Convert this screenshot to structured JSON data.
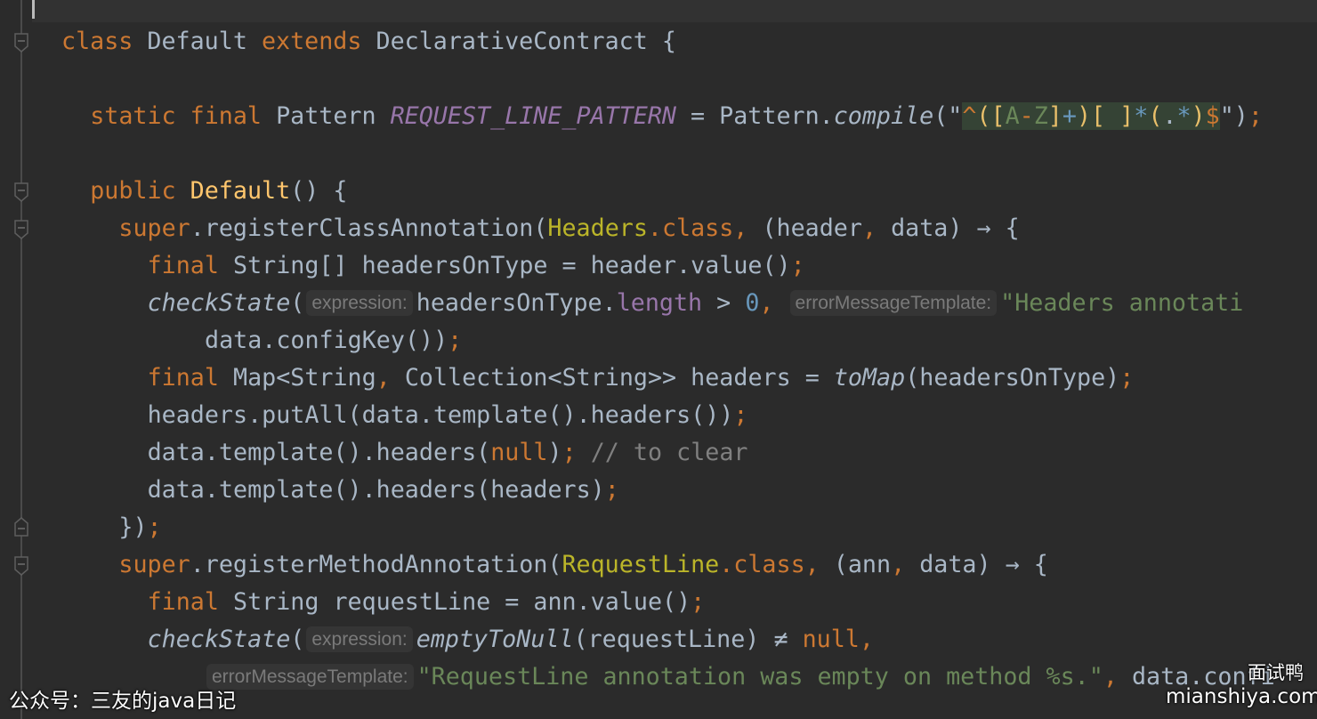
{
  "colors": {
    "background": "#2b2b2b",
    "keyword": "#cc7832",
    "text": "#a9b7c6",
    "string": "#6a8759",
    "number": "#6897bb",
    "static_field": "#9876aa",
    "method_decl": "#ffc66d",
    "comment": "#808080"
  },
  "editor": {
    "lines": [
      {
        "indent": 0,
        "tokens": []
      },
      {
        "indent": 0,
        "tokens": [
          {
            "t": "class",
            "c": "kw"
          },
          {
            "t": " Default ",
            "c": "pl"
          },
          {
            "t": "extends",
            "c": "kw"
          },
          {
            "t": " DeclarativeContract {",
            "c": "pl"
          }
        ]
      },
      {
        "indent": 0,
        "tokens": []
      },
      {
        "indent": 2,
        "tokens": [
          {
            "t": "static final",
            "c": "kw"
          },
          {
            "t": " Pattern ",
            "c": "pl"
          },
          {
            "t": "REQUEST_LINE_PATTERN",
            "c": "fld"
          },
          {
            "t": " = Pattern.",
            "c": "pl"
          },
          {
            "t": "compile",
            "c": "it"
          },
          {
            "t": "(\"",
            "c": "pl"
          },
          {
            "t": "^",
            "c": "rxo"
          },
          {
            "t": "([",
            "c": "rxy"
          },
          {
            "t": "A",
            "c": "rxg"
          },
          {
            "t": "-",
            "c": "rxo"
          },
          {
            "t": "Z",
            "c": "rxg"
          },
          {
            "t": "]",
            "c": "rxy"
          },
          {
            "t": "+",
            "c": "rxb"
          },
          {
            "t": ")[ ]",
            "c": "rxy"
          },
          {
            "t": "*",
            "c": "rxb"
          },
          {
            "t": "(",
            "c": "rxy"
          },
          {
            "t": ".",
            "c": "rxw"
          },
          {
            "t": "*",
            "c": "rxb"
          },
          {
            "t": ")",
            "c": "rxy"
          },
          {
            "t": "$",
            "c": "rxo"
          },
          {
            "t": "\")",
            "c": "pl"
          },
          {
            "t": ";",
            "c": "kw"
          }
        ]
      },
      {
        "indent": 0,
        "tokens": []
      },
      {
        "indent": 2,
        "tokens": [
          {
            "t": "public",
            "c": "kw"
          },
          {
            "t": " ",
            "c": "pl"
          },
          {
            "t": "Default",
            "c": "fn"
          },
          {
            "t": "() {",
            "c": "pl"
          }
        ]
      },
      {
        "indent": 4,
        "tokens": [
          {
            "t": "super",
            "c": "kw"
          },
          {
            "t": ".registerClassAnnotation(",
            "c": "pl"
          },
          {
            "t": "Headers",
            "c": "an"
          },
          {
            "t": ".class, ",
            "c": "kw"
          },
          {
            "t": "(header",
            "c": "pl"
          },
          {
            "t": ", ",
            "c": "kw"
          },
          {
            "t": "data) → {",
            "c": "pl"
          }
        ]
      },
      {
        "indent": 6,
        "tokens": [
          {
            "t": "final",
            "c": "kw"
          },
          {
            "t": " String[] headersOnType = header.value()",
            "c": "pl"
          },
          {
            "t": ";",
            "c": "kw"
          }
        ]
      },
      {
        "indent": 6,
        "tokens": [
          {
            "t": "checkState",
            "c": "it"
          },
          {
            "t": "(",
            "c": "pl"
          },
          {
            "t": "expression:",
            "c": "hint"
          },
          {
            "t": "headersOnType.",
            "c": "pl"
          },
          {
            "t": "length",
            "c": "prop"
          },
          {
            "t": " > ",
            "c": "pl"
          },
          {
            "t": "0",
            "c": "num"
          },
          {
            "t": ", ",
            "c": "kw"
          },
          {
            "t": "errorMessageTemplate:",
            "c": "hint"
          },
          {
            "t": "\"Headers annotati",
            "c": "str"
          }
        ]
      },
      {
        "indent": 10,
        "tokens": [
          {
            "t": "data.configKey())",
            "c": "pl"
          },
          {
            "t": ";",
            "c": "kw"
          }
        ]
      },
      {
        "indent": 6,
        "tokens": [
          {
            "t": "final",
            "c": "kw"
          },
          {
            "t": " Map<String",
            "c": "pl"
          },
          {
            "t": ", ",
            "c": "kw"
          },
          {
            "t": "Collection<String>> headers = ",
            "c": "pl"
          },
          {
            "t": "toMap",
            "c": "it"
          },
          {
            "t": "(headersOnType)",
            "c": "pl"
          },
          {
            "t": ";",
            "c": "kw"
          }
        ]
      },
      {
        "indent": 6,
        "tokens": [
          {
            "t": "headers.putAll(data.template().headers())",
            "c": "pl"
          },
          {
            "t": ";",
            "c": "kw"
          }
        ]
      },
      {
        "indent": 6,
        "tokens": [
          {
            "t": "data.template().headers(",
            "c": "pl"
          },
          {
            "t": "null",
            "c": "kw"
          },
          {
            "t": ")",
            "c": "pl"
          },
          {
            "t": ";",
            "c": "kw"
          },
          {
            "t": " // to clear",
            "c": "cm"
          }
        ]
      },
      {
        "indent": 6,
        "tokens": [
          {
            "t": "data.template().headers(headers)",
            "c": "pl"
          },
          {
            "t": ";",
            "c": "kw"
          }
        ]
      },
      {
        "indent": 4,
        "tokens": [
          {
            "t": "})",
            "c": "pl"
          },
          {
            "t": ";",
            "c": "kw"
          }
        ]
      },
      {
        "indent": 4,
        "tokens": [
          {
            "t": "super",
            "c": "kw"
          },
          {
            "t": ".registerMethodAnnotation(",
            "c": "pl"
          },
          {
            "t": "RequestLine",
            "c": "an"
          },
          {
            "t": ".class, ",
            "c": "kw"
          },
          {
            "t": "(ann",
            "c": "pl"
          },
          {
            "t": ", ",
            "c": "kw"
          },
          {
            "t": "data) → {",
            "c": "pl"
          }
        ]
      },
      {
        "indent": 6,
        "tokens": [
          {
            "t": "final",
            "c": "kw"
          },
          {
            "t": " String requestLine = ann.value()",
            "c": "pl"
          },
          {
            "t": ";",
            "c": "kw"
          }
        ]
      },
      {
        "indent": 6,
        "tokens": [
          {
            "t": "checkState",
            "c": "it"
          },
          {
            "t": "(",
            "c": "pl"
          },
          {
            "t": "expression:",
            "c": "hint"
          },
          {
            "t": "emptyToNull",
            "c": "it"
          },
          {
            "t": "(requestLine) ≠ ",
            "c": "pl"
          },
          {
            "t": "null",
            "c": "kw"
          },
          {
            "t": ",",
            "c": "kw"
          }
        ]
      },
      {
        "indent": 10,
        "tokens": [
          {
            "t": "errorMessageTemplate:",
            "c": "hint"
          },
          {
            "t": "\"RequestLine annotation was empty on method %s.\"",
            "c": "str"
          },
          {
            "t": ", ",
            "c": "kw"
          },
          {
            "t": "data.confi",
            "c": "pl"
          }
        ]
      }
    ]
  },
  "watermarks": {
    "left": "公众号：三友的java日记",
    "right_title": "面试鸭",
    "right_url": "mianshiya.com"
  }
}
